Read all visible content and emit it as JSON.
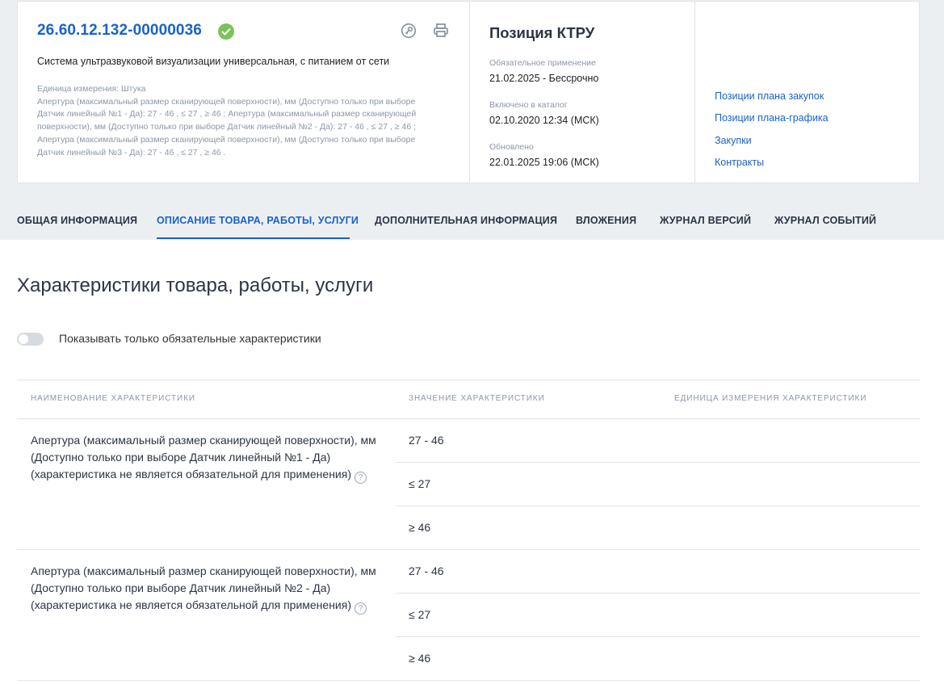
{
  "card": {
    "code": "26.60.12.132-00000036",
    "name": "Система ультразвуковой визуализации универсальная, с питанием от сети",
    "details": [
      "Единица измерения: Штука",
      "Апертура (максимальный размер сканирующей поверхности), мм (Доступно только при выборе",
      "Датчик линейный №1 - Да): 27 - 46 , ≤ 27 , ≥ 46 ; Апертура (максимальный размер сканирующей",
      "поверхности), мм (Доступно только при выборе Датчик линейный №2 - Да): 27 - 46 , ≤ 27 , ≥ 46 ;",
      "Апертура (максимальный размер сканирующей поверхности), мм (Доступно только при выборе",
      "Датчик линейный №3 - Да): 27 - 46 , ≤ 27 , ≥ 46 ."
    ],
    "position_title": "Позиция КТРУ",
    "mandatory_label": "Обязательное применение",
    "mandatory_value": "21.02.2025  - Бессрочно",
    "included_label": "Включено в каталог",
    "included_value": "02.10.2020 12:34 (МСК)",
    "updated_label": "Обновлено",
    "updated_value": "22.01.2025 19:06 (МСК)",
    "links": [
      "Позиции плана закупок",
      "Позиции плана-графика",
      "Закупки",
      "Контракты"
    ]
  },
  "tabs": [
    "ОБЩАЯ ИНФОРМАЦИЯ",
    "ОПИСАНИЕ ТОВАРА, РАБОТЫ, УСЛУГИ",
    "ДОПОЛНИТЕЛЬНАЯ ИНФОРМАЦИЯ",
    "ВЛОЖЕНИЯ",
    "ЖУРНАЛ ВЕРСИЙ",
    "ЖУРНАЛ СОБЫТИЙ"
  ],
  "active_tab": "ОПИСАНИЕ ТОВАРА, РАБОТЫ, УСЛУГИ",
  "section": {
    "title": "Характеристики товара, работы, услуги",
    "toggle_label": "Показывать только обязательные характеристики",
    "toggle_on": false
  },
  "table": {
    "headers": [
      "НАИМЕНОВАНИЕ ХАРАКТЕРИСТИКИ",
      "ЗНАЧЕНИЕ ХАРАКТЕРИСТИКИ",
      "ЕДИНИЦА ИЗМЕРЕНИЯ ХАРАКТЕРИСТИКИ"
    ],
    "rows": [
      {
        "name_lines": [
          "Апертура (максимальный размер сканирующей поверхности), мм",
          "(Доступно только при выборе Датчик линейный №1 - Да)",
          "(характеристика не является обязательной для применения)"
        ],
        "values": [
          "27 - 46",
          "≤ 27",
          "≥ 46"
        ],
        "unit": ""
      },
      {
        "name_lines": [
          "Апертура (максимальный размер сканирующей поверхности), мм",
          "(Доступно только при выборе Датчик линейный №2 - Да)",
          "(характеристика не является обязательной для применения)"
        ],
        "values": [
          "27 - 46",
          "≤ 27",
          "≥ 46"
        ],
        "unit": ""
      }
    ]
  },
  "colors": {
    "accent": "#1a63c6",
    "check": "#7dc25a",
    "band": "#eceff2"
  },
  "icons": [
    "check-circle-icon",
    "key-icon",
    "printer-icon",
    "help-icon"
  ]
}
